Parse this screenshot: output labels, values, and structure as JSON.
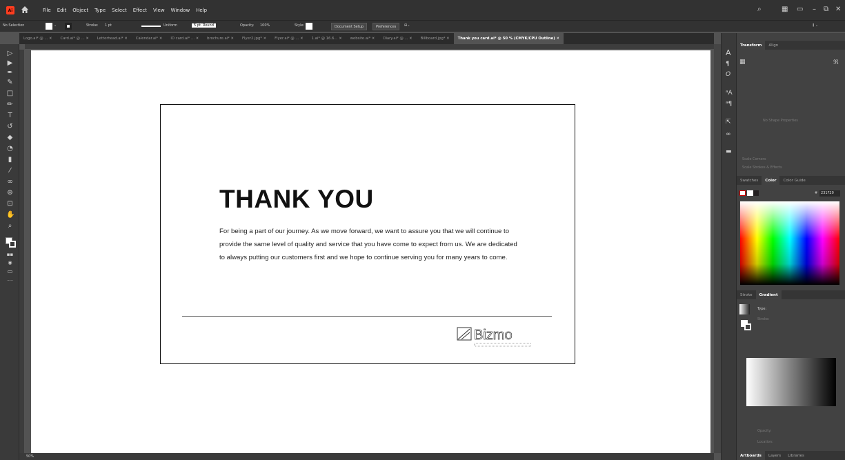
{
  "app": {
    "menu": [
      "File",
      "Edit",
      "Object",
      "Type",
      "Select",
      "Effect",
      "View",
      "Window",
      "Help"
    ]
  },
  "control": {
    "selection": "No Selection",
    "stroke_label": "Stroke:",
    "stroke_value": "1 pt",
    "profile": "Uniform",
    "brush": "5 pt. Round",
    "opacity_label": "Opacity:",
    "opacity_value": "100%",
    "style_label": "Style:",
    "doc_setup": "Document Setup",
    "preferences": "Preferences"
  },
  "tabs": [
    "Logo.ai* @ ...",
    "Card.ai* @ ...",
    "Letterhead.ai*",
    "Calendar.ai*",
    "ID card.ai* ...",
    "brochure.ai*",
    "Flyer2.jpg*",
    "Flyer.ai* @ ...",
    "1.ai* @ 16.6...",
    "website.ai*",
    "Diary.ai* @ ...",
    "Billboard.jpg*",
    "Thank you card.ai* @ 50 % (CMYK/CPU Outline)"
  ],
  "artboard": {
    "title": "THANK YOU",
    "body": "For being a part of our journey. As we move forward, we want to assure you that we will continue to provide the same level of quality and service that you have come to expect from us. We are dedicated to always putting our customers first and we hope to continue serving you for many years to come.",
    "brand": "Bizmo"
  },
  "panels": {
    "transform_tabs": [
      "Transform",
      "Align"
    ],
    "no_shape": "No Shape Properties",
    "scale_corners": "Scale Corners",
    "scale_strokes": "Scale Strokes & Effects",
    "color_tabs": [
      "Swatches",
      "Color",
      "Color Guide"
    ],
    "hex_label": "#",
    "hex_value": "231F20",
    "stroke_tabs": [
      "Stroke",
      "Gradient"
    ],
    "type_label": "Type:",
    "stroke_label": "Stroke:",
    "opacity_label": "Opacity:",
    "location_label": "Location:",
    "bottom_tabs": [
      "Artboards",
      "Layers",
      "Libraries"
    ]
  },
  "status": {
    "zoom": "50%"
  },
  "colors": {
    "ai_logo": "#ff3d1f",
    "app_bg": "#535353",
    "panel_bg": "#424242"
  }
}
